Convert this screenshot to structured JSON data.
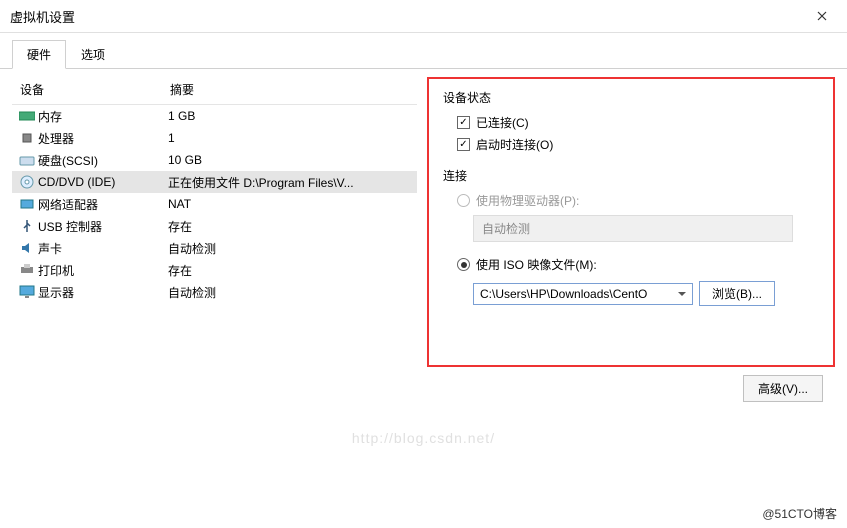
{
  "window": {
    "title": "虚拟机设置"
  },
  "tabs": {
    "hardware": "硬件",
    "options": "选项"
  },
  "table": {
    "header_device": "设备",
    "header_summary": "摘要",
    "rows": [
      {
        "device": "内存",
        "summary": "1 GB"
      },
      {
        "device": "处理器",
        "summary": "1"
      },
      {
        "device": "硬盘(SCSI)",
        "summary": "10 GB"
      },
      {
        "device": "CD/DVD (IDE)",
        "summary": "正在使用文件 D:\\Program Files\\V..."
      },
      {
        "device": "网络适配器",
        "summary": "NAT"
      },
      {
        "device": "USB 控制器",
        "summary": "存在"
      },
      {
        "device": "声卡",
        "summary": "自动检测"
      },
      {
        "device": "打印机",
        "summary": "存在"
      },
      {
        "device": "显示器",
        "summary": "自动检测"
      }
    ]
  },
  "status": {
    "title": "设备状态",
    "connected": "已连接(C)",
    "connect_at_power": "启动时连接(O)"
  },
  "connection": {
    "title": "连接",
    "physical": "使用物理驱动器(P):",
    "physical_value": "自动检测",
    "iso": "使用 ISO 映像文件(M):",
    "iso_value": "C:\\Users\\HP\\Downloads\\CentO",
    "browse": "浏览(B)..."
  },
  "advanced": "高级(V)...",
  "watermark": "http://blog.csdn.net/",
  "footer": "@51CTO博客"
}
